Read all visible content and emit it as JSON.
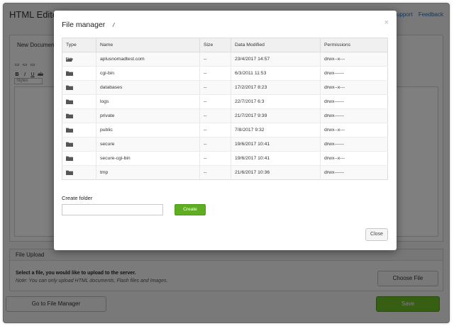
{
  "app": {
    "title": "HTML Editor",
    "links": [
      "Support",
      "Feedback"
    ],
    "document_tab": "New Document",
    "styles_placeholder": "Styles"
  },
  "upload": {
    "heading": "File Upload",
    "instruction": "Select a file, you would like to upload to the server.",
    "note": "Note: You can only upload HTML documents, Flash files and Images.",
    "choose_label": "Choose File"
  },
  "footer": {
    "go_label": "Go to File Manager",
    "save_label": "Save"
  },
  "modal": {
    "title": "File manager",
    "path": "/",
    "close_symbol": "×",
    "columns": [
      "Type",
      "Name",
      "Size",
      "Data Modified",
      "Permissions"
    ],
    "rows": [
      {
        "name": "aplusnomadtest.com",
        "size": "--",
        "date": "23/4/2017 14:57",
        "perm": "drwx--x---",
        "icon": "folder-open-icon"
      },
      {
        "name": "cgi-bin",
        "size": "--",
        "date": "6/3/2011 11:53",
        "perm": "drwx------",
        "icon": "folder-icon"
      },
      {
        "name": "databases",
        "size": "--",
        "date": "17/2/2017 8:23",
        "perm": "drwx--x---",
        "icon": "folder-icon"
      },
      {
        "name": "logs",
        "size": "--",
        "date": "22/7/2017 6:3",
        "perm": "drwx------",
        "icon": "folder-icon"
      },
      {
        "name": "private",
        "size": "--",
        "date": "21/7/2017 9:39",
        "perm": "drwx------",
        "icon": "folder-icon"
      },
      {
        "name": "public",
        "size": "--",
        "date": "7/8/2017 9:32",
        "perm": "drwx--x---",
        "icon": "folder-icon"
      },
      {
        "name": "secure",
        "size": "--",
        "date": "19/6/2017 10:41",
        "perm": "drwx------",
        "icon": "folder-icon"
      },
      {
        "name": "secure-cgi-bin",
        "size": "--",
        "date": "19/6/2017 10:41",
        "perm": "drwx--x---",
        "icon": "folder-icon"
      },
      {
        "name": "tmp",
        "size": "--",
        "date": "21/6/2017 10:36",
        "perm": "drwx------",
        "icon": "folder-icon"
      }
    ],
    "create_folder_label": "Create folder",
    "create_folder_value": "",
    "create_label": "Create",
    "close_label": "Close"
  },
  "colors": {
    "accent_green": "#6cbf26",
    "link_blue": "#2a6db5",
    "overlay": "#000000"
  }
}
